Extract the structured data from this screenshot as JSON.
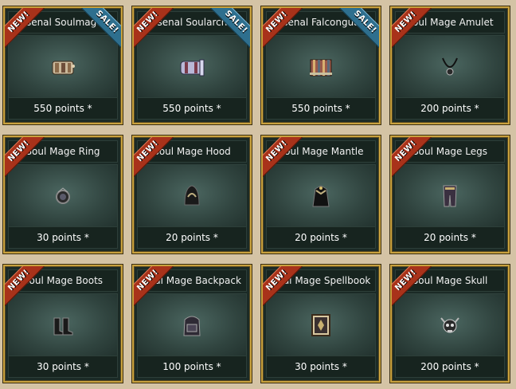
{
  "shop": {
    "items": [
      {
        "name": "Arsenal Soulmage's",
        "price": "550 points *",
        "new": "NEW!",
        "sale": "SALE!",
        "icon": "arsenal-soulmage-icon"
      },
      {
        "name": "Arsenal Soularcher",
        "price": "550 points *",
        "new": "NEW!",
        "sale": "SALE!",
        "icon": "arsenal-soularcher-icon"
      },
      {
        "name": "Arsenal Falconguard",
        "price": "550 points *",
        "new": "NEW!",
        "sale": "SALE!",
        "icon": "arsenal-falconguard-icon"
      },
      {
        "name": "Soul Mage Amulet",
        "price": "200 points *",
        "new": "NEW!",
        "icon": "amulet-icon"
      },
      {
        "name": "Soul Mage Ring",
        "price": "30 points *",
        "new": "NEW!",
        "icon": "ring-icon"
      },
      {
        "name": "Soul Mage Hood",
        "price": "20 points *",
        "new": "NEW!",
        "icon": "hood-icon"
      },
      {
        "name": "Soul Mage Mantle",
        "price": "20 points *",
        "new": "NEW!",
        "icon": "mantle-icon"
      },
      {
        "name": "Soul Mage Legs",
        "price": "20 points *",
        "new": "NEW!",
        "icon": "legs-icon"
      },
      {
        "name": "Soul Mage Boots",
        "price": "30 points *",
        "new": "NEW!",
        "icon": "boots-icon"
      },
      {
        "name": "Soul Mage Backpack",
        "price": "100 points *",
        "new": "NEW!",
        "icon": "backpack-icon"
      },
      {
        "name": "Soul Mage Spellbook",
        "price": "30 points *",
        "new": "NEW!",
        "icon": "spellbook-icon"
      },
      {
        "name": "Soul Mage Skull",
        "price": "200 points *",
        "new": "NEW!",
        "icon": "skull-icon"
      }
    ]
  }
}
